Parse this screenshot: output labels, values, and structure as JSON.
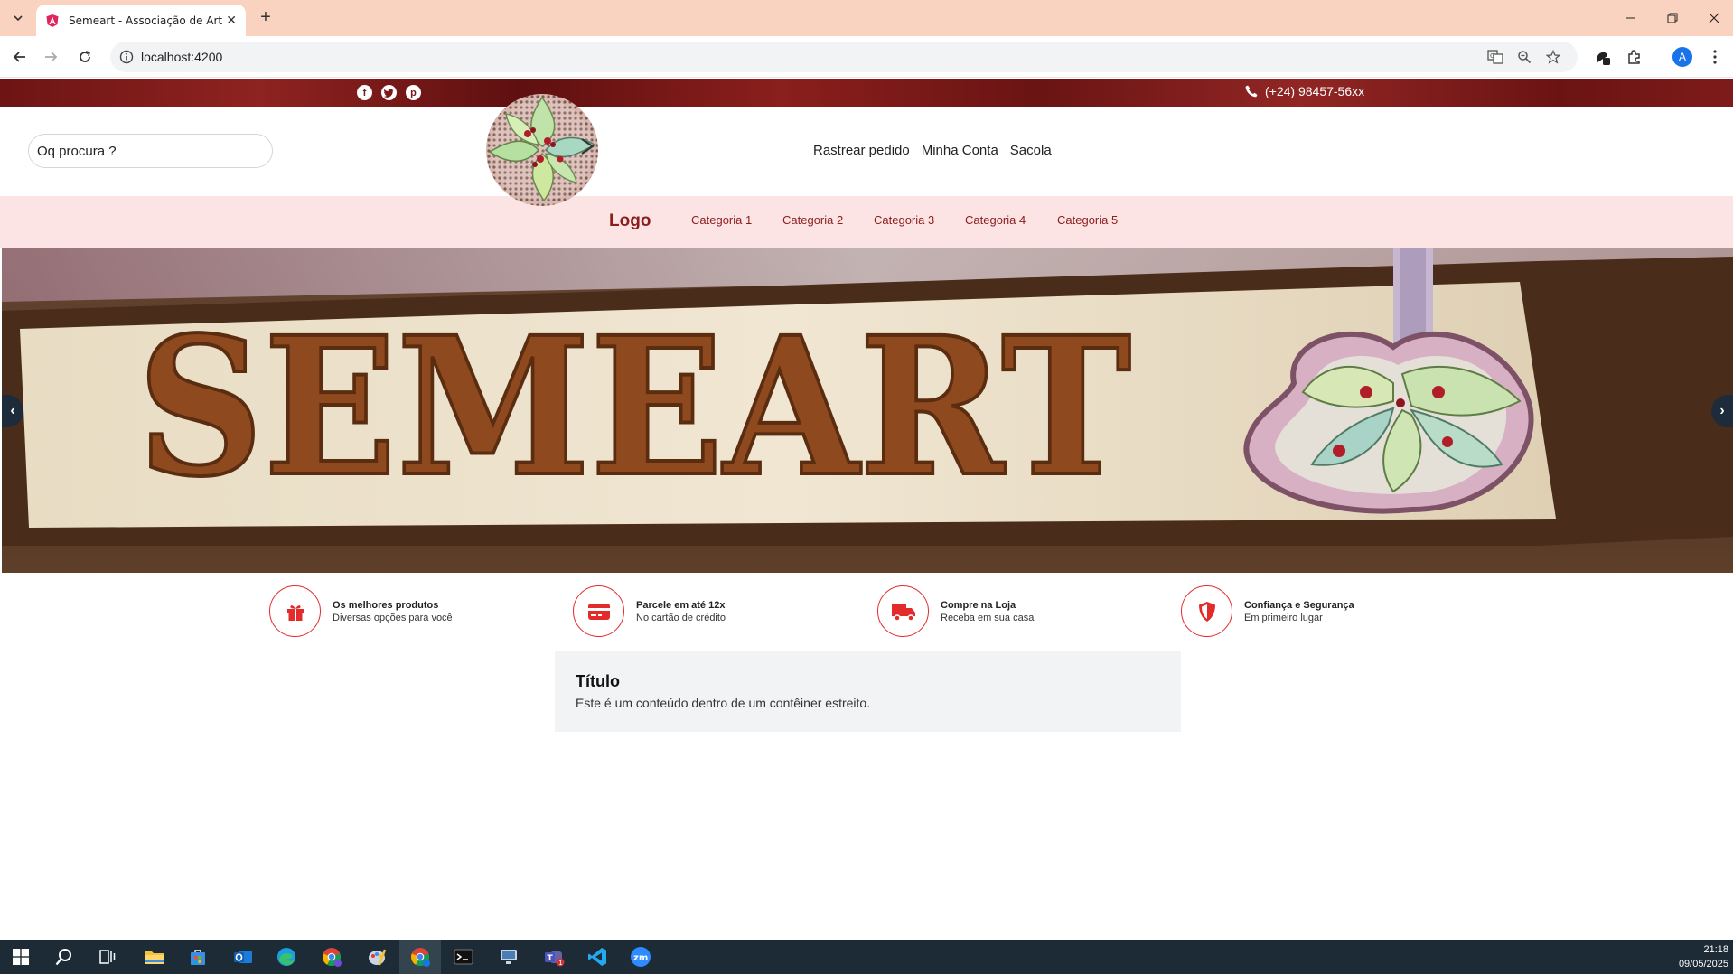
{
  "browser": {
    "tab_title": "Semeart - Associação de Artesã",
    "url": "localhost:4200"
  },
  "topbar": {
    "social": [
      "facebook-icon",
      "twitter-icon",
      "pinterest-icon"
    ],
    "phone": "(+24) 98457-56xx"
  },
  "header": {
    "search_placeholder": "Oq procura ?",
    "links": [
      "Rastrear pedido",
      "Minha Conta",
      "Sacola"
    ]
  },
  "catbar": {
    "logo": "Logo",
    "categories": [
      "Categoria 1",
      "Categoria 2",
      "Categoria 3",
      "Categoria 4",
      "Categoria 5"
    ]
  },
  "carousel": {
    "sign_text": "SEMEART",
    "prev": "‹",
    "next": "›"
  },
  "features": [
    {
      "title": "Os melhores produtos",
      "subtitle": "Diversas opções para você",
      "icon": "gift-icon"
    },
    {
      "title": "Parcele em até 12x",
      "subtitle": "No cartão de crédito",
      "icon": "credit-card-icon"
    },
    {
      "title": "Compre na Loja",
      "subtitle": "Receba em sua casa",
      "icon": "truck-icon"
    },
    {
      "title": "Confiança e Segurança",
      "subtitle": "Em primeiro lugar",
      "icon": "shield-icon"
    }
  ],
  "content": {
    "title": "Título",
    "text": "Este é um conteúdo dentro de um contêiner estreito."
  },
  "taskbar": {
    "time": "21:18",
    "date": "09/05/2025"
  },
  "colors": {
    "accent_red": "#e32b2b",
    "brand_maroon": "#8b1d1d",
    "catbar_pink": "#fde4e4",
    "browser_frame": "#f9d3bf"
  }
}
